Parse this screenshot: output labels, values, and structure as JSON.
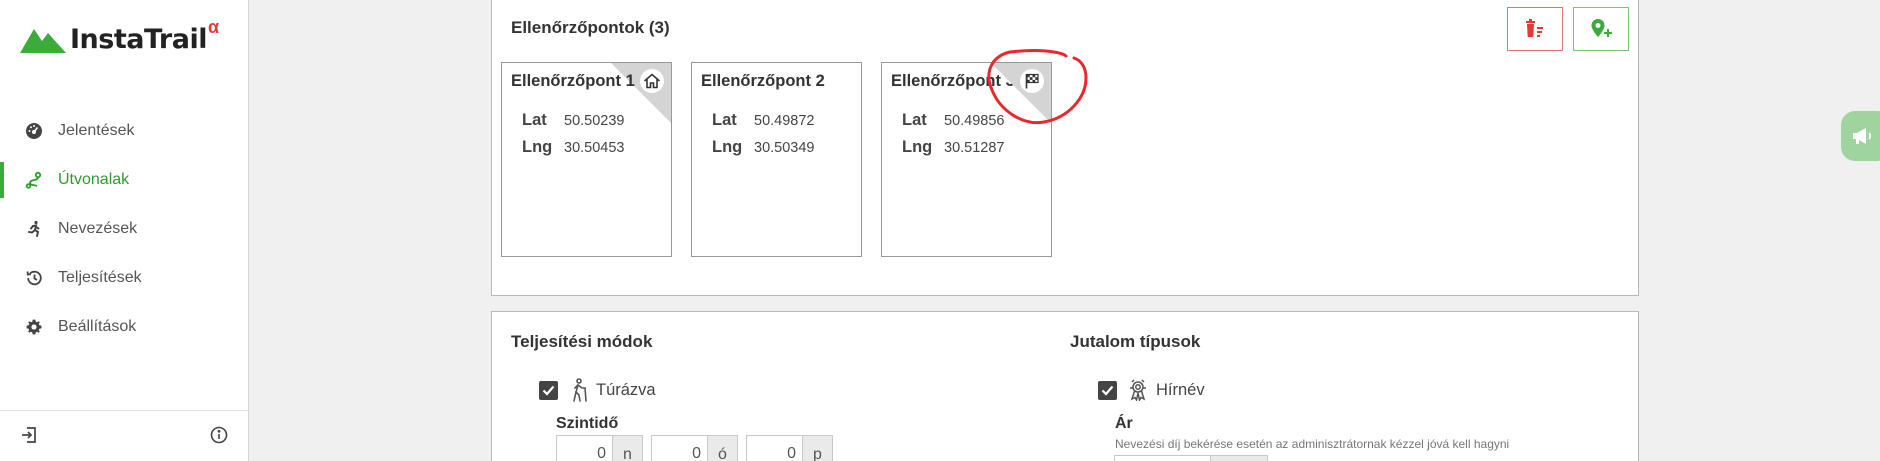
{
  "app": {
    "name": "InstaTrail",
    "superscript": "α"
  },
  "colors": {
    "brand_green": "#3bab3b",
    "danger_red": "#e53935",
    "annotation_red": "#e8282c"
  },
  "sidebar": {
    "items": [
      {
        "label": "Jelentések",
        "icon": "dashboard-icon",
        "active": false
      },
      {
        "label": "Útvonalak",
        "icon": "route-icon",
        "active": true
      },
      {
        "label": "Nevezések",
        "icon": "runner-icon",
        "active": false
      },
      {
        "label": "Teljesítések",
        "icon": "history-icon",
        "active": false
      },
      {
        "label": "Beállítások",
        "icon": "gear-icon",
        "active": false
      }
    ],
    "bottom": {
      "logout_icon": "logout-icon",
      "info_icon": "info-icon"
    }
  },
  "checkpoints": {
    "title": "Ellenőrzőpontok (3)",
    "delete_icon": "trash-list-icon",
    "add_icon": "add-location-icon",
    "lat_label": "Lat",
    "lng_label": "Lng",
    "items": [
      {
        "name": "Ellenőrzőpont 1",
        "lat": "50.50239",
        "lng": "30.50453",
        "corner_icon": "home-icon"
      },
      {
        "name": "Ellenőrzőpont 2",
        "lat": "50.49872",
        "lng": "30.50349",
        "corner_icon": ""
      },
      {
        "name": "Ellenőrzőpont 3",
        "lat": "50.49856",
        "lng": "30.51287",
        "corner_icon": "checkered-flag-icon"
      }
    ]
  },
  "modes": {
    "completion_title": "Teljesítési módok",
    "option_hiking": {
      "label": "Túrázva",
      "checked": true,
      "icon": "hiking-icon"
    },
    "time_limit_label": "Szintidő",
    "time_fields": [
      {
        "value": "0",
        "unit": "n"
      },
      {
        "value": "0",
        "unit": "ó"
      },
      {
        "value": "0",
        "unit": "p"
      }
    ],
    "reward_title": "Jutalom típusok",
    "option_reputation": {
      "label": "Hírnév",
      "checked": true,
      "icon": "medal-icon"
    },
    "price_label": "Ár",
    "price_hint": "Nevezési díj bekérése esetén az adminisztrátornak kézzel jóvá kell hagyni"
  },
  "feedback_icon": "megaphone-icon"
}
